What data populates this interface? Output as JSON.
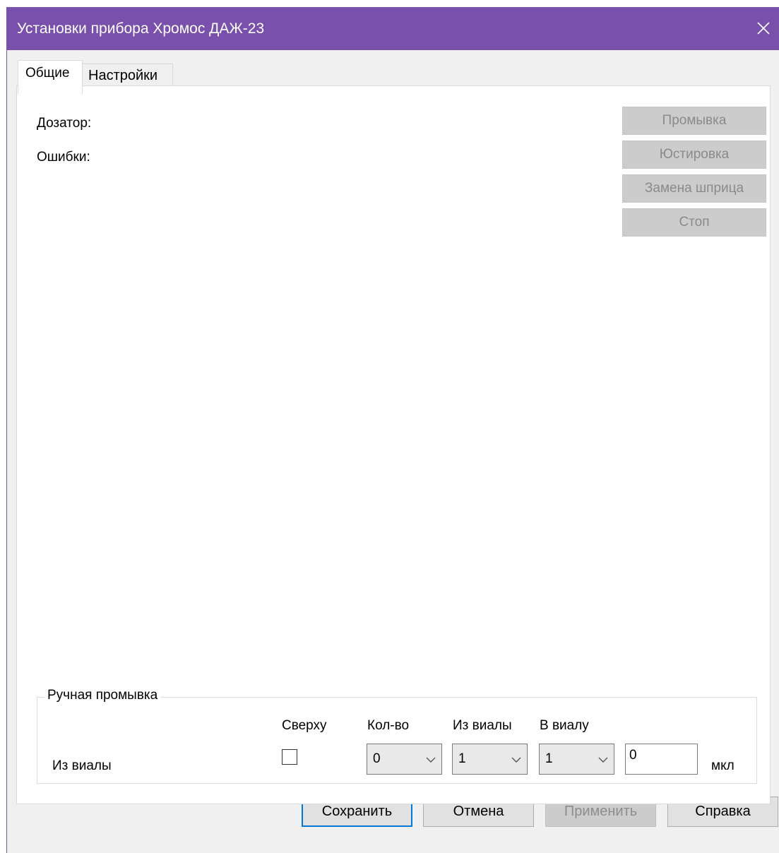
{
  "window": {
    "title": "Установки прибора Хромос ДАЖ-23",
    "close_icon": "close-icon"
  },
  "tabs": [
    {
      "label": "Общие",
      "active": true
    },
    {
      "label": "Настройки",
      "active": false
    }
  ],
  "general": {
    "dozator_label": "Дозатор:",
    "errors_label": "Ошибки:"
  },
  "side_buttons": [
    {
      "label": "Промывка",
      "enabled": false
    },
    {
      "label": "Юстировка",
      "enabled": false
    },
    {
      "label": "Замена шприца",
      "enabled": false
    },
    {
      "label": "Стоп",
      "enabled": false
    }
  ],
  "manual_wash": {
    "group_title": "Ручная промывка",
    "col_top": "Сверху",
    "col_count": "Кол-во",
    "col_from_vial": "Из виалы",
    "col_to_vial": "В виалу",
    "row_label": "Из виалы",
    "top_checked": false,
    "count_value": "0",
    "from_vial_value": "1",
    "to_vial_value": "1",
    "volume_value": "0",
    "unit": "мкл"
  },
  "footer": {
    "save": "Сохранить",
    "cancel": "Отмена",
    "apply": "Применить",
    "help": "Справка"
  },
  "colors": {
    "titlebar": "#7951ad",
    "default_button_border": "#0078d7"
  }
}
